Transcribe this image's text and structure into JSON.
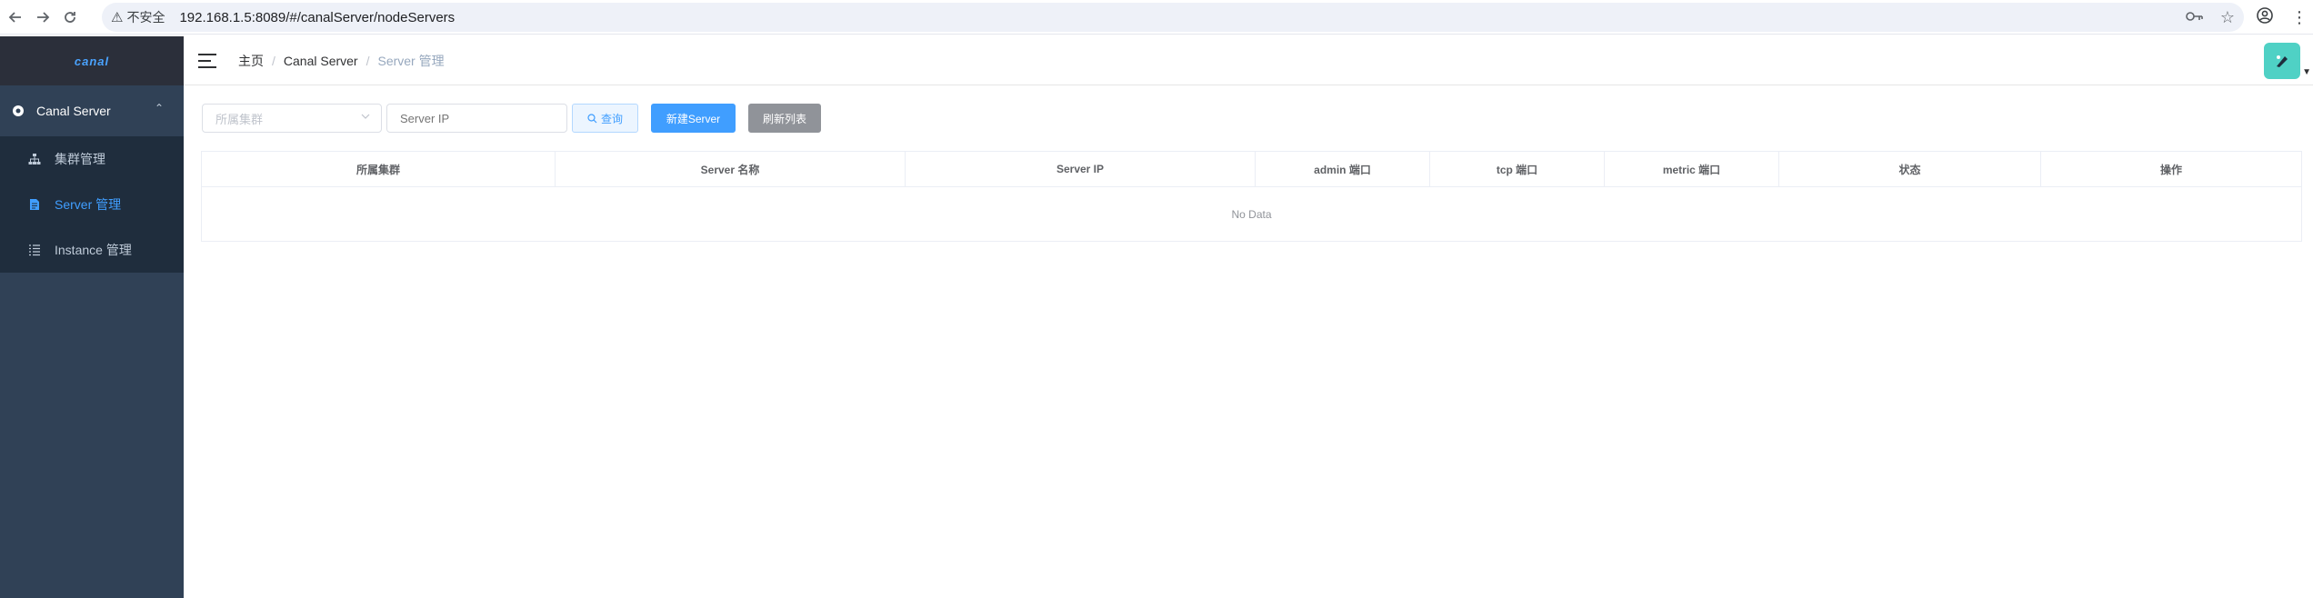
{
  "browser": {
    "back_icon": "arrow-left-icon",
    "forward_icon": "arrow-right-icon",
    "reload_icon": "reload-icon",
    "security_label": "不安全",
    "url": "192.168.1.5:8089/#/canalServer/nodeServers"
  },
  "sidebar": {
    "logo_text": "canal",
    "parent": {
      "label": "Canal Server",
      "icon": "gear-icon",
      "expanded": true
    },
    "items": [
      {
        "label": "集群管理",
        "icon": "cluster-icon",
        "active": false
      },
      {
        "label": "Server 管理",
        "icon": "document-icon",
        "active": true
      },
      {
        "label": "Instance 管理",
        "icon": "list-icon",
        "active": false
      }
    ]
  },
  "header": {
    "breadcrumb": [
      "主页",
      "Canal Server",
      "Server 管理"
    ]
  },
  "filters": {
    "cluster_placeholder": "所属集群",
    "server_ip_placeholder": "Server IP",
    "query_label": "查询",
    "new_label": "新建Server",
    "refresh_label": "刷新列表"
  },
  "table": {
    "columns": [
      "所属集群",
      "Server 名称",
      "Server IP",
      "admin 端口",
      "tcp 端口",
      "metric 端口",
      "状态",
      "操作"
    ],
    "empty_text": "No Data"
  },
  "colors": {
    "sidebar_bg": "#304156",
    "submenu_bg": "#1f2d3d",
    "accent": "#409eff",
    "refresh_btn": "#909399",
    "avatar_bg": "#4fd1c5"
  }
}
